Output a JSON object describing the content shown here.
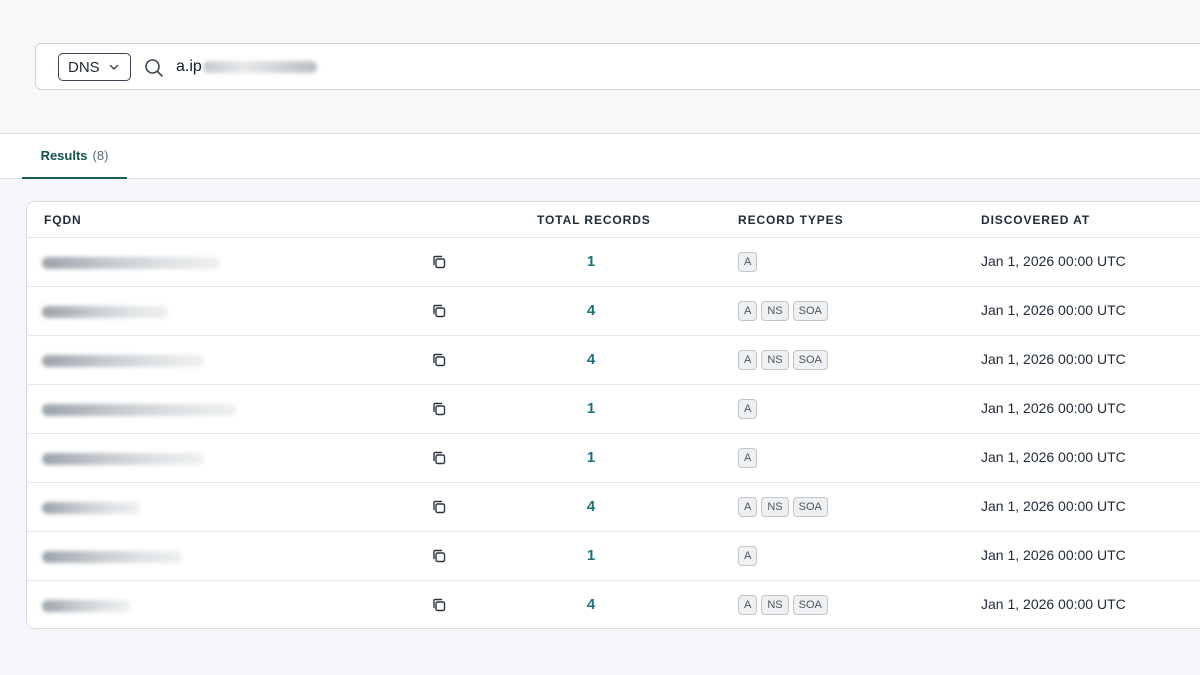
{
  "search": {
    "type_label": "DNS",
    "query_prefix": "a.ip"
  },
  "tabs": [
    {
      "label": "Results",
      "count": "(8)"
    }
  ],
  "table": {
    "headers": {
      "fqdn": "FQDN",
      "total_records": "TOTAL RECORDS",
      "record_types": "RECORD TYPES",
      "discovered_at": "DISCOVERED AT"
    },
    "rows": [
      {
        "total": "1",
        "types": [
          "A"
        ],
        "discovered": "Jan 1, 2026 00:00 UTC"
      },
      {
        "total": "4",
        "types": [
          "A",
          "NS",
          "SOA"
        ],
        "discovered": "Jan 1, 2026 00:00 UTC"
      },
      {
        "total": "4",
        "types": [
          "A",
          "NS",
          "SOA"
        ],
        "discovered": "Jan 1, 2026 00:00 UTC"
      },
      {
        "total": "1",
        "types": [
          "A"
        ],
        "discovered": "Jan 1, 2026 00:00 UTC"
      },
      {
        "total": "1",
        "types": [
          "A"
        ],
        "discovered": "Jan 1, 2026 00:00 UTC"
      },
      {
        "total": "4",
        "types": [
          "A",
          "NS",
          "SOA"
        ],
        "discovered": "Jan 1, 2026 00:00 UTC"
      },
      {
        "total": "1",
        "types": [
          "A"
        ],
        "discovered": "Jan 1, 2026 00:00 UTC"
      },
      {
        "total": "4",
        "types": [
          "A",
          "NS",
          "SOA"
        ],
        "discovered": "Jan 1, 2026 00:00 UTC"
      }
    ]
  },
  "icons": {
    "type_dropdown": "chevron-down-icon",
    "search": "search-icon",
    "copy": "copy-icon"
  },
  "colors": {
    "accent": "#14514d",
    "count_link": "#1a6f7a"
  }
}
